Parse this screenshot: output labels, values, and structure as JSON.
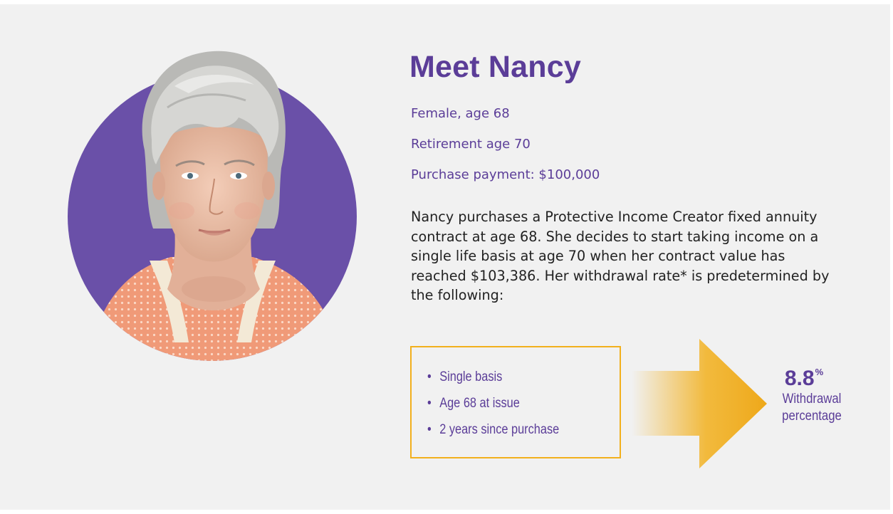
{
  "profile": {
    "title": "Meet Nancy",
    "facts": [
      "Female, age 68",
      "Retirement age 70",
      "Purchase payment: $100,000"
    ],
    "description": "Nancy purchases a Protective Income Creator fixed annuity contract at age 68. She decides to start taking income on a single life basis at age 70 when her contract value has reached $103,386. Her withdrawal rate* is predetermined by the following:"
  },
  "criteria": {
    "items": [
      "Single basis",
      "Age 68 at issue",
      "2 years since purchase"
    ],
    "bullet": "•"
  },
  "result": {
    "value": "8.8",
    "unit": "%",
    "label_line1": "Withdrawal",
    "label_line2": "percentage"
  },
  "colors": {
    "brand_purple": "#5b3d98",
    "circle_purple": "#6a50a8",
    "accent_gold": "#f2b01d",
    "panel_background": "#f1f1f1"
  },
  "icons": {
    "portrait": "woman-portrait-image",
    "arrow": "right-arrow-icon"
  }
}
